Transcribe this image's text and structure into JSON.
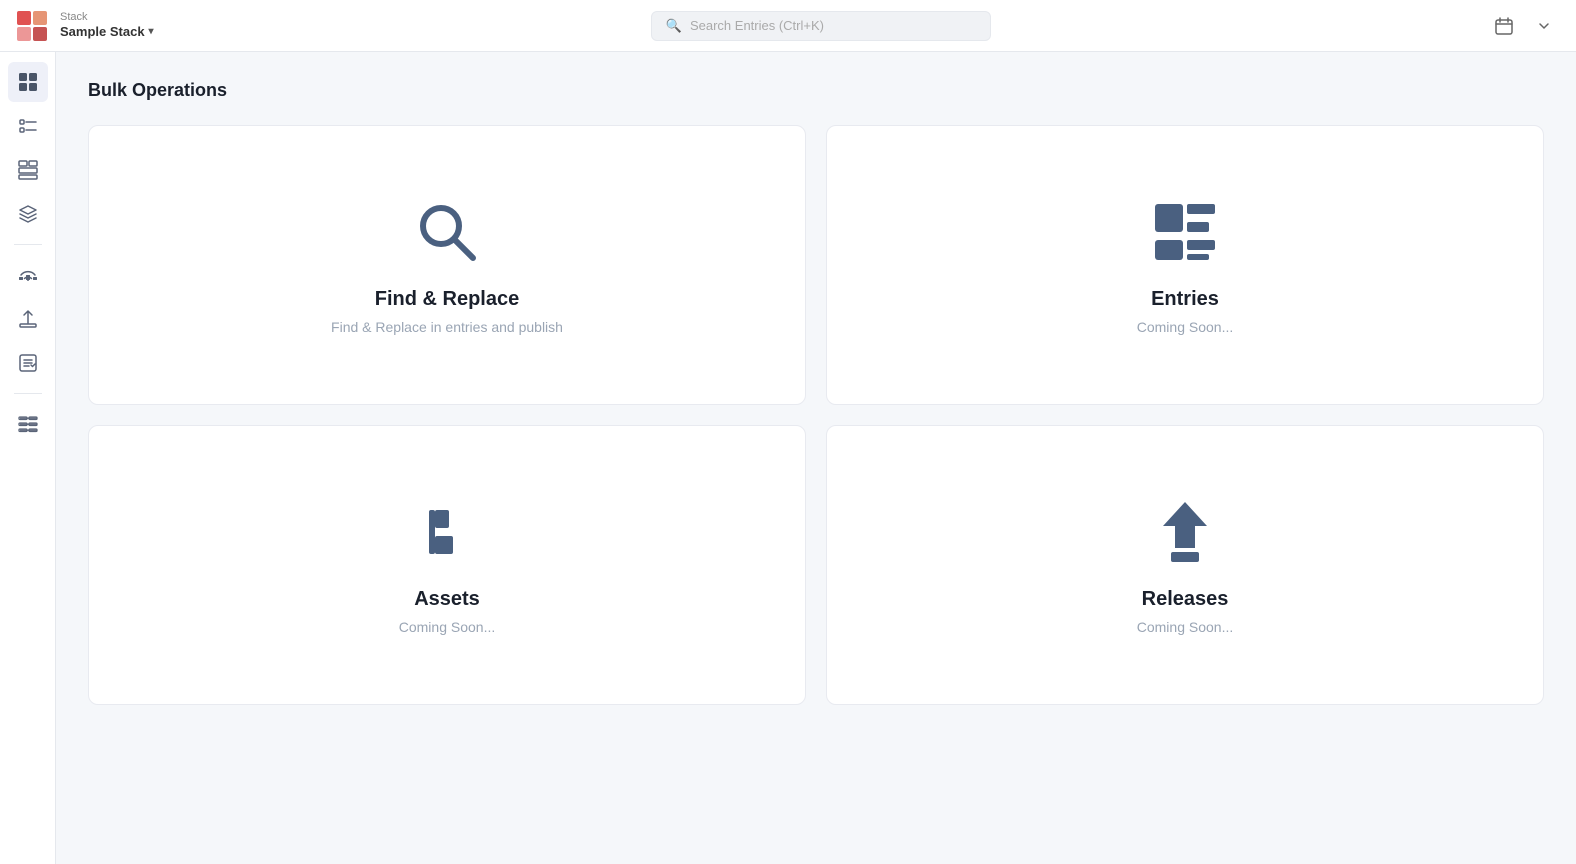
{
  "topbar": {
    "stack_label": "Stack",
    "stack_name": "Sample Stack",
    "search_placeholder": "Search Entries (Ctrl+K)"
  },
  "sidebar": {
    "items": [
      {
        "id": "dashboard",
        "label": "Dashboard",
        "active": true
      },
      {
        "id": "entries",
        "label": "Entries"
      },
      {
        "id": "widgets",
        "label": "Widgets"
      },
      {
        "id": "content-types",
        "label": "Content Types"
      },
      {
        "id": "media",
        "label": "Media"
      },
      {
        "id": "releases",
        "label": "Releases"
      },
      {
        "id": "tasks",
        "label": "Tasks"
      },
      {
        "id": "settings",
        "label": "Settings"
      }
    ]
  },
  "main": {
    "page_title": "Bulk Operations",
    "cards": [
      {
        "id": "find-replace",
        "title": "Find & Replace",
        "subtitle": "Find & Replace in entries and publish",
        "coming_soon": false
      },
      {
        "id": "entries",
        "title": "Entries",
        "subtitle": "Coming Soon...",
        "coming_soon": true
      },
      {
        "id": "assets",
        "title": "Assets",
        "subtitle": "Coming Soon...",
        "coming_soon": true
      },
      {
        "id": "releases",
        "title": "Releases",
        "subtitle": "Coming Soon...",
        "coming_soon": true
      }
    ]
  }
}
